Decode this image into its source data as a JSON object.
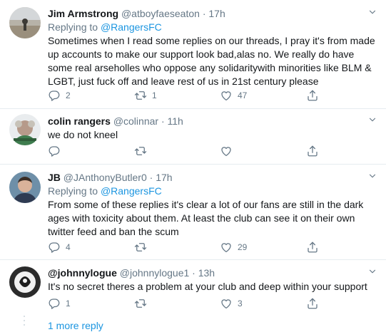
{
  "tweets": [
    {
      "name": "Jim Armstrong",
      "handle": "@atboyfaeseaton",
      "time": "17h",
      "replying_label": "Replying to",
      "replying_to": "@RangersFC",
      "text": "Sometimes when I read some replies on our threads, I pray it's from made up accounts to make our support look bad,alas no. We really do have some real arseholles who oppose any solidaritywith minorities like BLM & LGBT, just fuck off and leave rest of us in 21st century please",
      "replies": "2",
      "retweets": "1",
      "likes": "47"
    },
    {
      "name": "colin rangers",
      "handle": "@colinnar",
      "time": "11h",
      "text": "we do not kneel",
      "replies": "",
      "retweets": "",
      "likes": ""
    },
    {
      "name": "JB",
      "handle": "@JAnthonyButler0",
      "time": "17h",
      "replying_label": "Replying to",
      "replying_to": "@RangersFC",
      "text": "From some of these replies it's clear a lot of our fans are still in the dark ages with toxicity about them. At least the club can see it on their own twitter feed and ban the scum",
      "replies": "4",
      "retweets": "",
      "likes": "29"
    },
    {
      "name": "@johnnylogue",
      "handle": "@johnnylogue1",
      "time": "13h",
      "text": "It's no secret theres a problem at your club and deep within your support",
      "replies": "1",
      "retweets": "",
      "likes": "3"
    }
  ],
  "sep": "·",
  "more_replies": "1 more reply",
  "icons": {
    "reply": "reply-icon",
    "retweet": "retweet-icon",
    "like": "heart-icon",
    "share": "share-icon",
    "menu": "chevron-down-icon"
  },
  "colors": {
    "link": "#1b95e0",
    "muted": "#657786",
    "border": "#e6ecf0"
  }
}
